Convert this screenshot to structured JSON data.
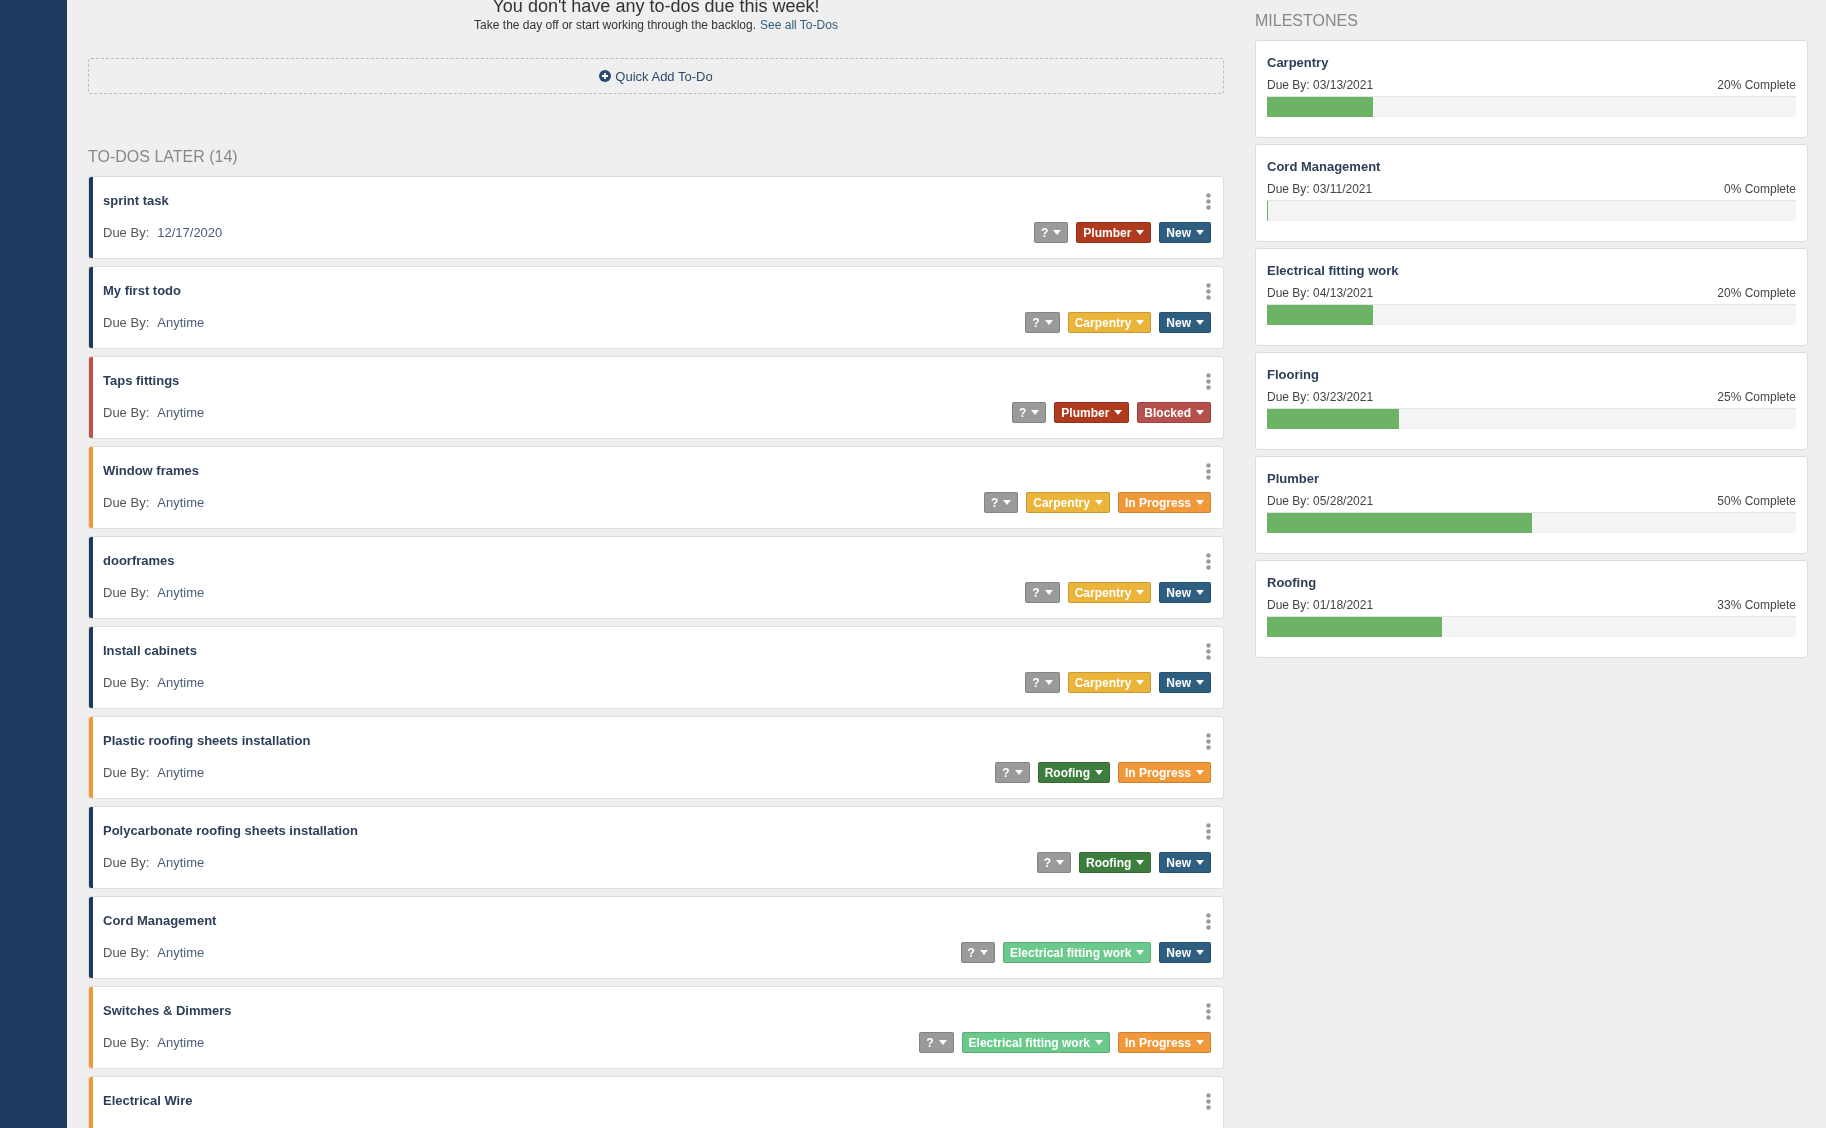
{
  "header": {
    "title": "You don't have any to-dos due this week!",
    "subtitle": "Take the day off or start working through the backlog.",
    "link": "See all To-Dos"
  },
  "quick_add": {
    "label": "Quick Add To-Do"
  },
  "todos_later": {
    "title": "TO-DOS LATER (14)",
    "items": [
      {
        "title": "sprint task",
        "due_label": "Due By:",
        "due": "12/17/2020",
        "color": "#1f3a5f",
        "tags": [
          {
            "label": "?",
            "color": "#9a9a9a"
          },
          {
            "label": "Plumber",
            "color": "#b03a1e"
          },
          {
            "label": "New",
            "color": "#2f5f80"
          }
        ]
      },
      {
        "title": "My first todo",
        "due_label": "Due By:",
        "due": "Anytime",
        "color": "#1f3a5f",
        "tags": [
          {
            "label": "?",
            "color": "#9a9a9a"
          },
          {
            "label": "Carpentry",
            "color": "#ebb43a"
          },
          {
            "label": "New",
            "color": "#2f5f80"
          }
        ]
      },
      {
        "title": "Taps fittings",
        "due_label": "Due By:",
        "due": "Anytime",
        "color": "#c0504d",
        "tags": [
          {
            "label": "?",
            "color": "#9a9a9a"
          },
          {
            "label": "Plumber",
            "color": "#b03a1e"
          },
          {
            "label": "Blocked",
            "color": "#b5504c"
          }
        ]
      },
      {
        "title": "Window frames",
        "due_label": "Due By:",
        "due": "Anytime",
        "color": "#f0993a",
        "tags": [
          {
            "label": "?",
            "color": "#9a9a9a"
          },
          {
            "label": "Carpentry",
            "color": "#ebb43a"
          },
          {
            "label": "In Progress",
            "color": "#f0993a"
          }
        ]
      },
      {
        "title": "doorframes",
        "due_label": "Due By:",
        "due": "Anytime",
        "color": "#1f3a5f",
        "tags": [
          {
            "label": "?",
            "color": "#9a9a9a"
          },
          {
            "label": "Carpentry",
            "color": "#ebb43a"
          },
          {
            "label": "New",
            "color": "#2f5f80"
          }
        ]
      },
      {
        "title": "Install cabinets",
        "due_label": "Due By:",
        "due": "Anytime",
        "color": "#1f3a5f",
        "tags": [
          {
            "label": "?",
            "color": "#9a9a9a"
          },
          {
            "label": "Carpentry",
            "color": "#ebb43a"
          },
          {
            "label": "New",
            "color": "#2f5f80"
          }
        ]
      },
      {
        "title": "Plastic roofing sheets installation",
        "due_label": "Due By:",
        "due": "Anytime",
        "color": "#f0993a",
        "tags": [
          {
            "label": "?",
            "color": "#9a9a9a"
          },
          {
            "label": "Roofing",
            "color": "#3d7d3d"
          },
          {
            "label": "In Progress",
            "color": "#f0993a"
          }
        ]
      },
      {
        "title": "Polycarbonate roofing sheets installation",
        "due_label": "Due By:",
        "due": "Anytime",
        "color": "#1f3a5f",
        "tags": [
          {
            "label": "?",
            "color": "#9a9a9a"
          },
          {
            "label": "Roofing",
            "color": "#3d7d3d"
          },
          {
            "label": "New",
            "color": "#2f5f80"
          }
        ]
      },
      {
        "title": "Cord Management",
        "due_label": "Due By:",
        "due": "Anytime",
        "color": "#1f3a5f",
        "tags": [
          {
            "label": "?",
            "color": "#9a9a9a"
          },
          {
            "label": "Electrical fitting work",
            "color": "#6cc98c"
          },
          {
            "label": "New",
            "color": "#2f5f80"
          }
        ]
      },
      {
        "title": "Switches & Dimmers",
        "due_label": "Due By:",
        "due": "Anytime",
        "color": "#f0993a",
        "tags": [
          {
            "label": "?",
            "color": "#9a9a9a"
          },
          {
            "label": "Electrical fitting work",
            "color": "#6cc98c"
          },
          {
            "label": "In Progress",
            "color": "#f0993a"
          }
        ]
      },
      {
        "title": "Electrical Wire",
        "color": "#f0993a"
      }
    ]
  },
  "milestones": {
    "title": "MILESTONES",
    "items": [
      {
        "name": "Carpentry",
        "due": "Due By: 03/13/2021",
        "complete": "20% Complete",
        "level": 0.2
      },
      {
        "name": "Cord Management",
        "due": "Due By: 03/11/2021",
        "complete": "0% Complete",
        "level": 0
      },
      {
        "name": "Electrical fitting work",
        "due": "Due By: 04/13/2021",
        "complete": "20% Complete",
        "level": 0.2
      },
      {
        "name": "Flooring",
        "due": "Due By: 03/23/2021",
        "complete": "25% Complete",
        "level": 0.25
      },
      {
        "name": "Plumber",
        "due": "Due By: 05/28/2021",
        "complete": "50% Complete",
        "level": 0.5
      },
      {
        "name": "Roofing",
        "due": "Due By: 01/18/2021",
        "complete": "33% Complete",
        "level": 0.33
      }
    ]
  }
}
